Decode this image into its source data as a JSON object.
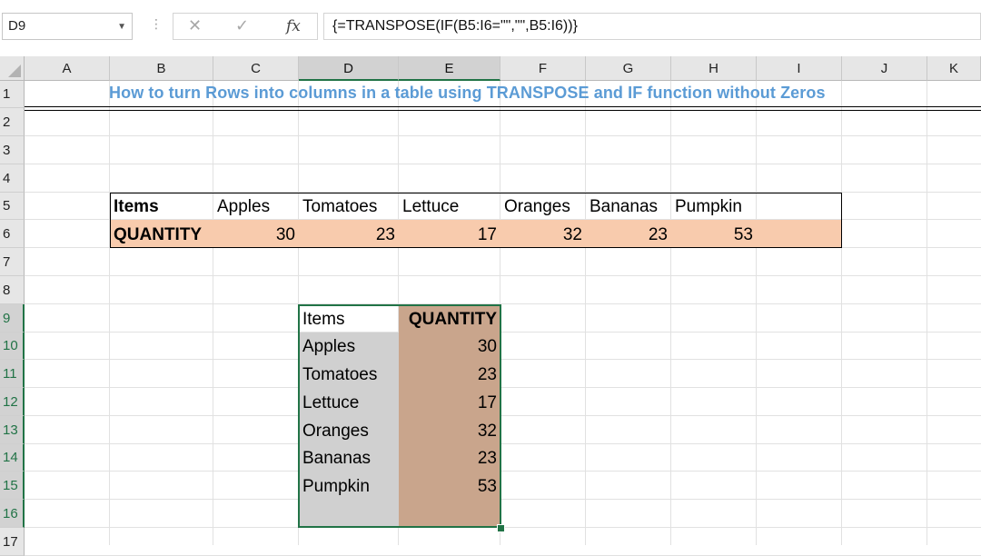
{
  "formula_bar": {
    "name_box": "D9",
    "cancel_icon": "close-icon",
    "enter_icon": "check-icon",
    "fx_label": "fx",
    "formula": "{=TRANSPOSE(IF(B5:I6=\"\",\"\",B5:I6))}"
  },
  "columns": [
    "A",
    "B",
    "C",
    "D",
    "E",
    "F",
    "G",
    "H",
    "I",
    "J",
    "K"
  ],
  "rows": [
    "1",
    "2",
    "3",
    "4",
    "5",
    "6",
    "7",
    "8",
    "9",
    "10",
    "11",
    "12",
    "13",
    "14",
    "15",
    "16",
    "17"
  ],
  "title": "How to turn Rows into columns in a table using TRANSPOSE and IF function without Zeros",
  "table1": {
    "header_label": "Items",
    "row_label": "QUANTITY",
    "items": [
      "Apples",
      "Tomatoes",
      "Lettuce",
      "Oranges",
      "Bananas",
      "Pumpkin"
    ],
    "quantities": [
      "30",
      "23",
      "17",
      "32",
      "23",
      "53"
    ]
  },
  "table2": {
    "header_items": "Items",
    "header_qty": "QUANTITY",
    "items": [
      "Apples",
      "Tomatoes",
      " Lettuce",
      "Oranges",
      "Bananas",
      "Pumpkin"
    ],
    "quantities": [
      "30",
      "23",
      "17",
      "32",
      "23",
      "53"
    ]
  },
  "colors": {
    "accent": "#217346",
    "title": "#5b9bd5",
    "row_fill": "#f8cbad",
    "transposed_fill": "#c9a58c"
  }
}
